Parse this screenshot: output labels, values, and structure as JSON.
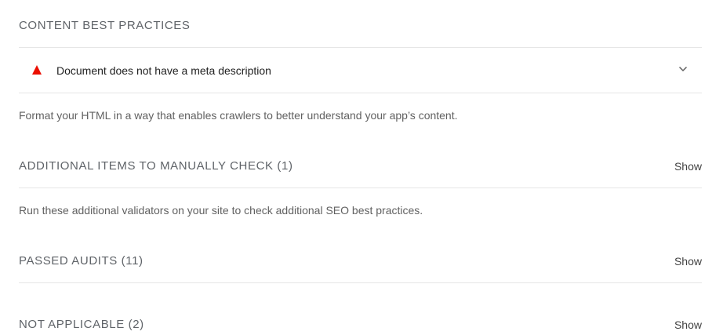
{
  "content_best_practices": {
    "title": "CONTENT BEST PRACTICES",
    "audit": {
      "status": "fail",
      "status_color": "#eb0f00",
      "title": "Document does not have a meta description"
    },
    "description": "Format your HTML in a way that enables crawlers to better understand your app’s content."
  },
  "manual_check": {
    "title": "ADDITIONAL ITEMS TO MANUALLY CHECK (1)",
    "toggle_label": "Show",
    "description": "Run these additional validators on your site to check additional SEO best practices."
  },
  "passed_audits": {
    "title": "PASSED AUDITS (11)",
    "toggle_label": "Show"
  },
  "not_applicable": {
    "title": "NOT APPLICABLE (2)",
    "toggle_label": "Show"
  }
}
